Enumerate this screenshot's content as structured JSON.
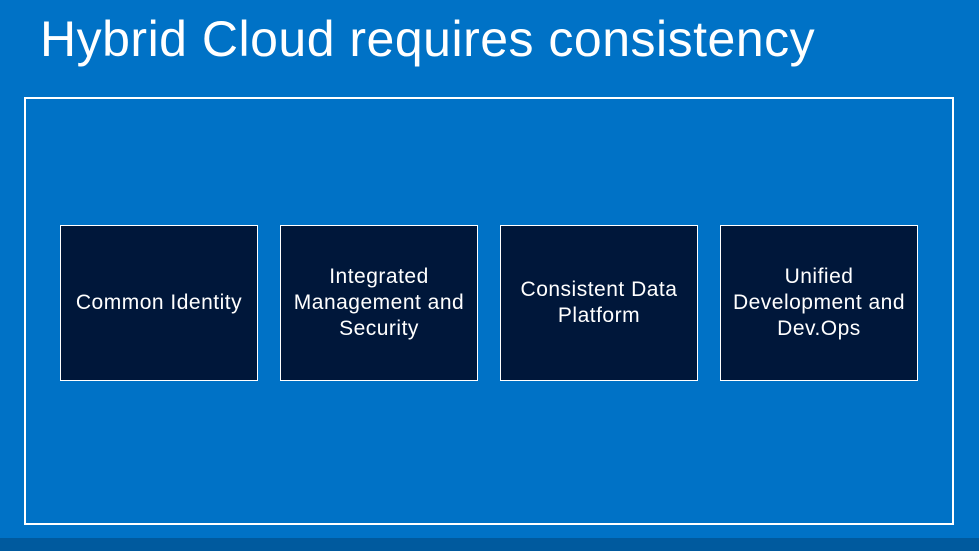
{
  "title": "Hybrid Cloud requires consistency",
  "cards": [
    {
      "label": "Common Identity"
    },
    {
      "label": "Integrated Management and Security"
    },
    {
      "label": "Consistent Data Platform"
    },
    {
      "label": "Unified Development and Dev.Ops"
    }
  ]
}
